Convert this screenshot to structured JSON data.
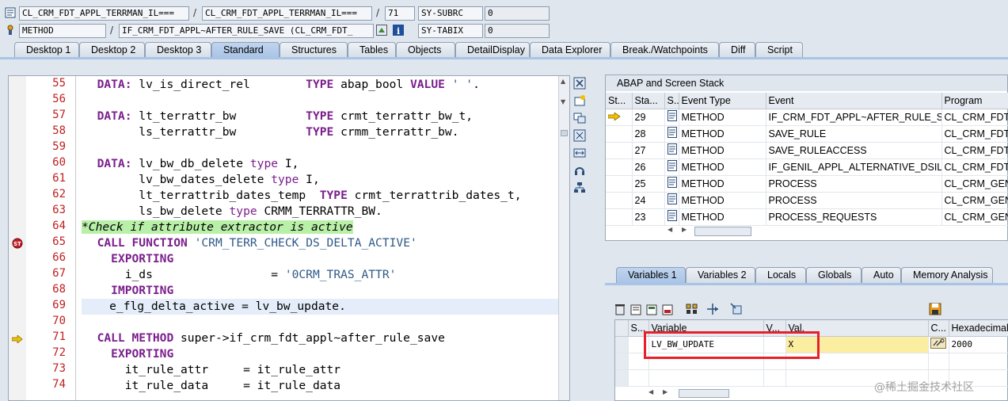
{
  "header": {
    "row1": {
      "field1": "CL_CRM_FDT_APPL_TERRMAN_IL===",
      "field2": "CL_CRM_FDT_APPL_TERRMAN_IL===",
      "line": "71",
      "sysvar": "SY-SUBRC",
      "sysval": "0"
    },
    "row2": {
      "type": "METHOD",
      "name": "IF_CRM_FDT_APPL~AFTER_RULE_SAVE (CL_CRM_FDT_",
      "sysvar": "SY-TABIX",
      "sysval": "0"
    },
    "slash": "/"
  },
  "tabs": [
    "Desktop 1",
    "Desktop 2",
    "Desktop 3",
    "Standard",
    "Structures",
    "Tables",
    "Objects",
    "DetailDisplay",
    "Data Explorer",
    "Break./Watchpoints",
    "Diff",
    "Script"
  ],
  "editor": {
    "line_numbers": [
      "55",
      "56",
      "57",
      "58",
      "59",
      "60",
      "61",
      "62",
      "63",
      "64",
      "65",
      "66",
      "67",
      "68",
      "69",
      "70",
      "71",
      "72",
      "73",
      "74"
    ]
  },
  "stack": {
    "title": "ABAP and Screen Stack",
    "columns": [
      "St...",
      "Sta...",
      "S...",
      "Event Type",
      "Event",
      "Program"
    ],
    "rows": [
      {
        "level": "29",
        "type": "METHOD",
        "event": "IF_CRM_FDT_APPL~AFTER_RULE_SAVE",
        "program": "CL_CRM_FDT_A"
      },
      {
        "level": "28",
        "type": "METHOD",
        "event": "SAVE_RULE",
        "program": "CL_CRM_FDT_A"
      },
      {
        "level": "27",
        "type": "METHOD",
        "event": "SAVE_RULEACCESS",
        "program": "CL_CRM_FDT_A"
      },
      {
        "level": "26",
        "type": "METHOD",
        "event": "IF_GENIL_APPL_ALTERNATIVE_DSIL~...",
        "program": "CL_CRM_FDT_I"
      },
      {
        "level": "25",
        "type": "METHOD",
        "event": "PROCESS",
        "program": "CL_CRM_GENER"
      },
      {
        "level": "24",
        "type": "METHOD",
        "event": "PROCESS",
        "program": "CL_CRM_GENER"
      },
      {
        "level": "23",
        "type": "METHOD",
        "event": "PROCESS_REQUESTS",
        "program": "CL_CRM_GENER"
      }
    ]
  },
  "vartabs": [
    "Variables 1",
    "Variables 2",
    "Locals",
    "Globals",
    "Auto",
    "Memory Analysis"
  ],
  "vars": {
    "columns": [
      "S...",
      "Variable",
      "V...",
      "Val.",
      "C...",
      "Hexadecimal V"
    ],
    "rows": [
      {
        "variable": "LV_BW_UPDATE",
        "value": "X",
        "hex": "2000"
      }
    ]
  },
  "watermark": "@稀土掘金技术社区",
  "colors": {
    "highlight": "#e8202a",
    "comment_bg": "#b8f0a8",
    "keyword": "#7a1f8c",
    "string": "#2e5a87",
    "line_number": "#c02020"
  }
}
